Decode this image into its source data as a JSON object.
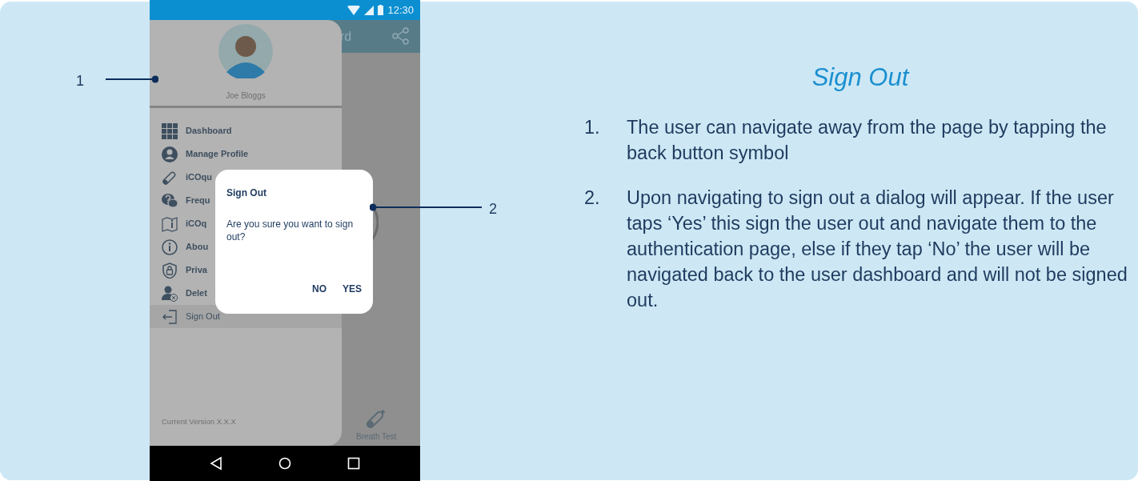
{
  "phone": {
    "status_bar": {
      "time": "12:30"
    },
    "app_bar": {
      "title": "rd"
    },
    "bottom_tab": {
      "label": "Breath Test"
    },
    "drawer": {
      "user_name": "Joe Bloggs",
      "version": "Current Version X.X.X",
      "items": [
        {
          "kind": "grid",
          "label": "Dashboard",
          "selected": false
        },
        {
          "kind": "profile",
          "label": "Manage Profile",
          "selected": false
        },
        {
          "kind": "pen",
          "label": "iCOqu",
          "selected": false
        },
        {
          "kind": "faq",
          "label": "Frequ",
          "selected": false
        },
        {
          "kind": "guide",
          "label": "iCOq",
          "selected": false
        },
        {
          "kind": "info",
          "label": "Abou",
          "selected": false
        },
        {
          "kind": "privacy",
          "label": "Priva",
          "selected": false
        },
        {
          "kind": "delete",
          "label": "Delet",
          "selected": false
        },
        {
          "kind": "signout",
          "label": "Sign Out",
          "selected": true
        }
      ]
    },
    "dialog": {
      "title": "Sign Out",
      "message": "Are you sure you want to sign out?",
      "buttons": [
        "NO",
        "YES"
      ]
    }
  },
  "callouts": [
    "1",
    "2"
  ],
  "notes": {
    "title": "Sign Out",
    "items": [
      {
        "number": "1.",
        "text": "The user can navigate away from the page by tapping the back button symbol"
      },
      {
        "number": "2.",
        "text": "Upon navigating to sign out a dialog will appear. If the user taps ‘Yes’ this sign the user out and navigate them to the authentication page, else if they tap ‘No’ the user will be navigated back to the user dashboard and will not be signed out."
      }
    ]
  }
}
